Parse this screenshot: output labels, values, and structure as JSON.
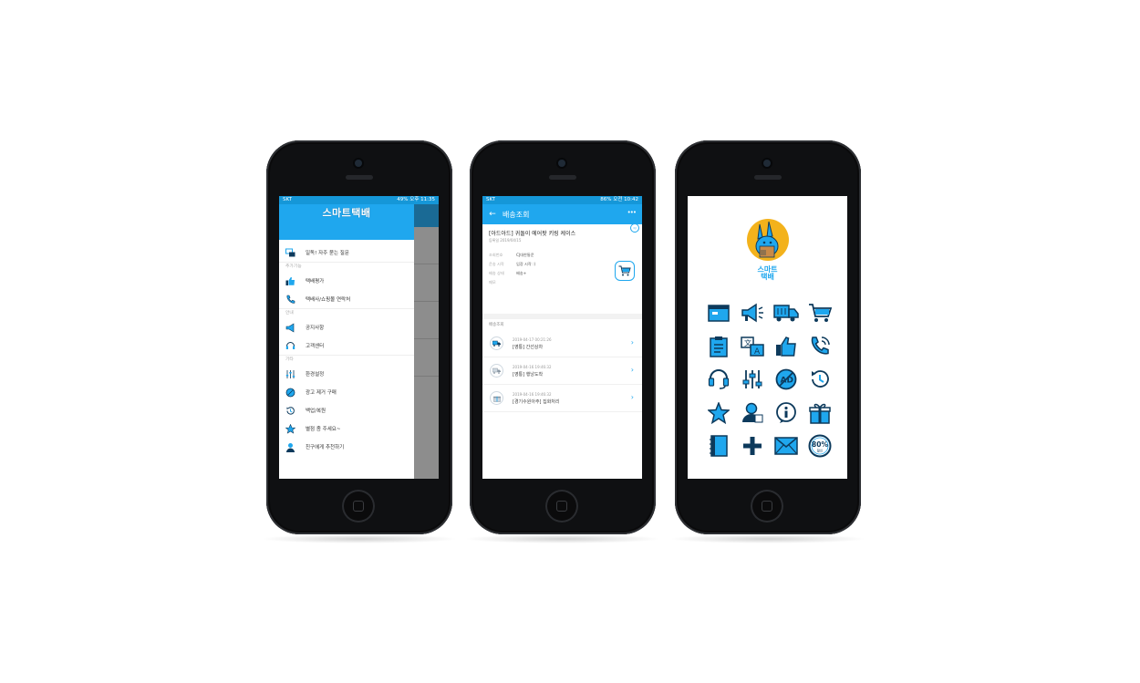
{
  "phone1": {
    "status_left": "SKT",
    "status_right": "49% 오후 11:35",
    "logo": "스마트택배",
    "faq": "일독! 자주 묻는 질문",
    "sections": {
      "extra": "추가기능",
      "guide": "안내",
      "etc": "기타"
    },
    "menu": {
      "rating": "택배평가",
      "contact": "택배사/쇼핑몰 연락처",
      "notice": "공지사항",
      "support": "고객센터",
      "settings": "환경설정",
      "remove_ads": "광고 제거 구매",
      "backup": "백업/복원",
      "review": "별점 좀 주세요~",
      "share": "친구에게 추천하기"
    }
  },
  "phone2": {
    "status_left": "SKT",
    "status_right": "86% 오전 10:42",
    "header_title": "배송조회",
    "item_title": "[아드아드] 귀돌이 에어팟 키링 케이스",
    "item_date": "등록일 2019/04/15",
    "fields": [
      {
        "key": "조회번호",
        "value": "CJ대한통운"
      },
      {
        "key": "운송 시작",
        "value": "입장 시작 :)"
      },
      {
        "key": "배송 상태",
        "value": "배송+"
      },
      {
        "key": "메모",
        "value": ""
      }
    ],
    "history_label": "배송조회",
    "history": [
      {
        "time": "2019-04-17 00:21:26",
        "desc": "[영통] 간선상차"
      },
      {
        "time": "2019-04-16 19:46:32",
        "desc": "[영통] 행낭도착"
      },
      {
        "time": "2019-04-16 19:46:32",
        "desc": "[경기수원아주] 집화처리"
      }
    ]
  },
  "phone3": {
    "logo_top": "스마트",
    "logo_bottom": "택배",
    "icons": [
      "box-icon",
      "megaphone-icon",
      "truck-icon",
      "cart-icon",
      "clipboard-icon",
      "translate-icon",
      "thumbs-up-icon",
      "phone-ring-icon",
      "headset-icon",
      "sliders-icon",
      "no-ads-icon",
      "history-icon",
      "star-icon",
      "user-stamp-icon",
      "info-bubble-icon",
      "gift-icon",
      "notebook-icon",
      "plus-icon",
      "envelope-icon",
      "discount-80-icon"
    ],
    "discount_label": "80%",
    "discount_sub": "할인"
  },
  "colors": {
    "accent": "#1fa7ee",
    "dark_navy": "#0d3a5c",
    "status_blue": "#1597d8"
  }
}
